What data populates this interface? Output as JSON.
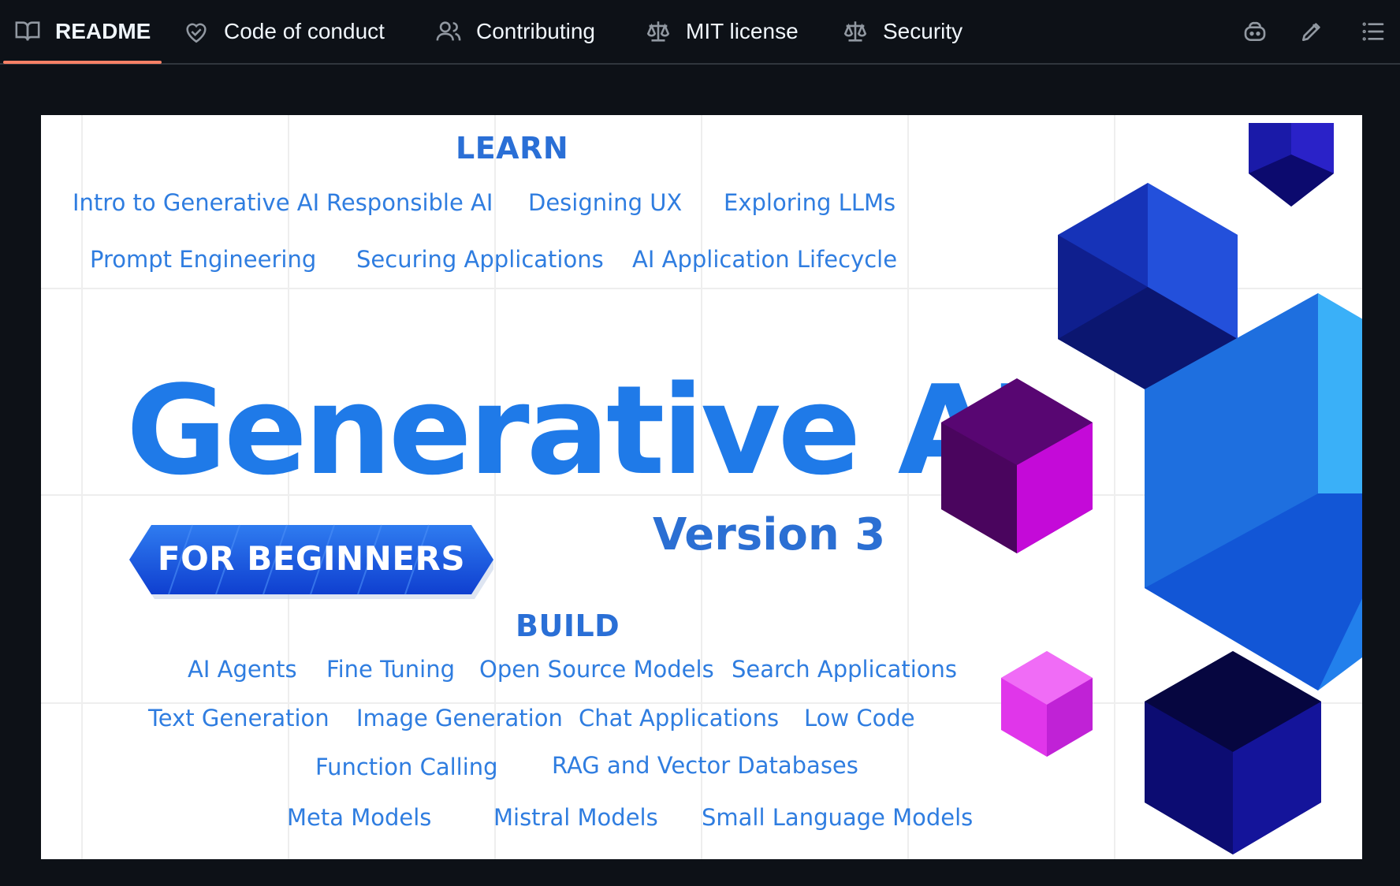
{
  "tabs": [
    {
      "id": "readme",
      "label": "README",
      "icon": "book-icon",
      "active": true
    },
    {
      "id": "code-of-conduct",
      "label": "Code of conduct",
      "icon": "heart-handshake-icon",
      "active": false
    },
    {
      "id": "contributing",
      "label": "Contributing",
      "icon": "people-icon",
      "active": false
    },
    {
      "id": "license",
      "label": "MIT license",
      "icon": "scale-icon",
      "active": false
    },
    {
      "id": "security",
      "label": "Security",
      "icon": "scale-icon",
      "active": false
    }
  ],
  "toolbar": {
    "icons": [
      "copilot-icon",
      "pencil-icon",
      "list-icon"
    ]
  },
  "banner": {
    "learn_heading": "LEARN",
    "learn_topics": [
      "Intro to Generative AI",
      "Responsible AI",
      "Designing UX",
      "Exploring LLMs",
      "Prompt Engineering",
      "Securing Applications",
      "AI Application Lifecycle"
    ],
    "title": "Generative AI",
    "version": "Version 3",
    "ribbon": "FOR BEGINNERS",
    "build_heading": "BUILD",
    "build_topics": [
      "AI Agents",
      "Fine Tuning",
      "Open Source Models",
      "Search Applications",
      "Text Generation",
      "Image Generation",
      "Chat Applications",
      "Low Code",
      "Function Calling",
      "RAG and Vector Databases",
      "Meta Models",
      "Mistral Models",
      "Small Language Models"
    ],
    "colors": {
      "title_blue": "#1f7ae8",
      "topic_blue": "#2f7de0",
      "accent": "#f78166"
    }
  }
}
